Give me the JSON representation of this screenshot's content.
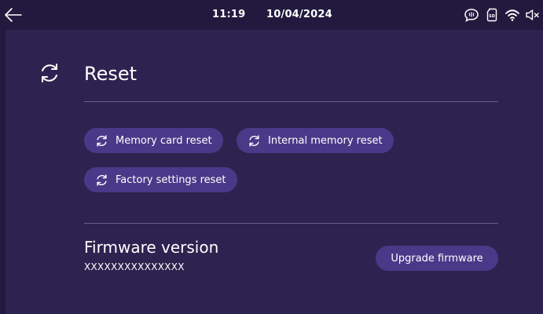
{
  "status_bar": {
    "time": "11:19",
    "date": "10/04/2024",
    "icons": [
      "back-arrow-icon",
      "intercom-bubble-icon",
      "sd-card-icon",
      "wifi-icon",
      "speaker-muted-icon"
    ]
  },
  "reset_section": {
    "title": "Reset",
    "icon": "reset-cycle-icon",
    "buttons": [
      {
        "label": "Memory card reset"
      },
      {
        "label": "Internal memory reset"
      },
      {
        "label": "Factory settings reset"
      }
    ]
  },
  "firmware_section": {
    "title": "Firmware version",
    "version": "XXXXXXXXXXXXXXX",
    "upgrade_label": "Upgrade firmware"
  },
  "colors": {
    "background": "#2e2350",
    "status_bar": "#221a3e",
    "button": "#4a3988",
    "divider": "#6a5f8c",
    "text": "#ffffff"
  }
}
